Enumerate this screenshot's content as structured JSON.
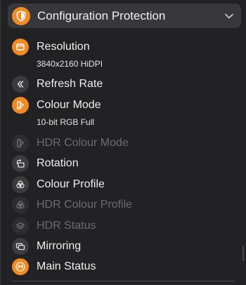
{
  "header": {
    "title": "Configuration Protection",
    "icon": "shield-icon",
    "accent": "#f08a24"
  },
  "items": [
    {
      "label": "Resolution",
      "icon": "display-icon",
      "sub": "3840x2160 HiDPI",
      "enabled": true
    },
    {
      "label": "Refresh Rate",
      "icon": "double-chevron-left-icon",
      "enabled": true
    },
    {
      "label": "Colour Mode",
      "icon": "colour-mode-icon",
      "sub": "10-bit RGB Full",
      "enabled": true
    },
    {
      "label": "HDR Colour Mode",
      "icon": "colour-mode-icon",
      "enabled": false
    },
    {
      "label": "Rotation",
      "icon": "rotation-icon",
      "enabled": true
    },
    {
      "label": "Colour Profile",
      "icon": "colour-profile-icon",
      "enabled": true
    },
    {
      "label": "HDR Colour Profile",
      "icon": "colour-profile-icon",
      "enabled": false
    },
    {
      "label": "HDR Status",
      "icon": "layers-icon",
      "enabled": false
    },
    {
      "label": "Mirroring",
      "icon": "mirroring-icon",
      "enabled": true
    },
    {
      "label": "Main Status",
      "icon": "main-status-icon",
      "enabled": true
    }
  ]
}
